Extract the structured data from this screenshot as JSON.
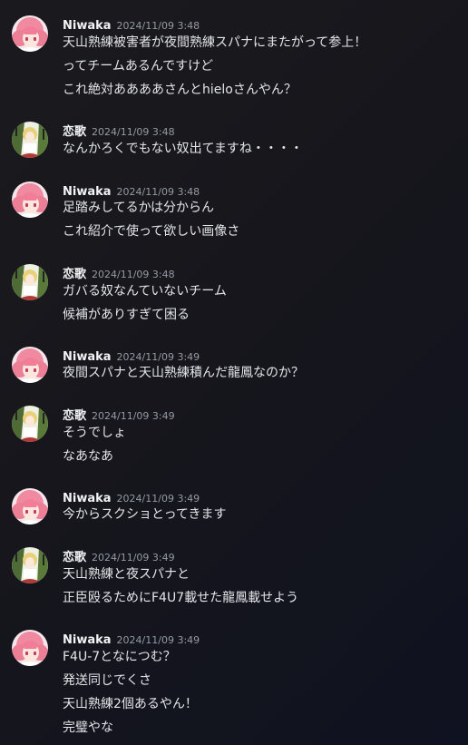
{
  "messages": [
    {
      "author": "Niwaka",
      "avatar": "niwaka-avatar",
      "timestamp": "2024/11/09 3:48",
      "lines": [
        "天山熟練被害者が夜間熟練スパナにまたがって参上！",
        "ってチームあるんですけど",
        "これ絶対ああああさんとhieloさんやん？"
      ]
    },
    {
      "author": "恋歌",
      "avatar": "renka-avatar",
      "timestamp": "2024/11/09 3:48",
      "lines": [
        "なんかろくでもない奴出てますね・・・・"
      ]
    },
    {
      "author": "Niwaka",
      "avatar": "niwaka-avatar",
      "timestamp": "2024/11/09 3:48",
      "lines": [
        "足踏みしてるかは分からん",
        "これ紹介で使って欲しい画像さ"
      ]
    },
    {
      "author": "恋歌",
      "avatar": "renka-avatar",
      "timestamp": "2024/11/09 3:48",
      "lines": [
        "ガバる奴なんていないチーム",
        "候補がありすぎて困る"
      ]
    },
    {
      "author": "Niwaka",
      "avatar": "niwaka-avatar",
      "timestamp": "2024/11/09 3:49",
      "lines": [
        "夜間スパナと天山熟練積んだ龍鳳なのか？"
      ]
    },
    {
      "author": "恋歌",
      "avatar": "renka-avatar",
      "timestamp": "2024/11/09 3:49",
      "lines": [
        "そうでしょ",
        "なあなあ"
      ]
    },
    {
      "author": "Niwaka",
      "avatar": "niwaka-avatar",
      "timestamp": "2024/11/09 3:49",
      "lines": [
        "今からスクショとってきます"
      ]
    },
    {
      "author": "恋歌",
      "avatar": "renka-avatar",
      "timestamp": "2024/11/09 3:49",
      "lines": [
        "天山熟練と夜スパナと",
        "正臣殴るためにF4U7載せた龍鳳載せよう"
      ]
    },
    {
      "author": "Niwaka",
      "avatar": "niwaka-avatar",
      "timestamp": "2024/11/09 3:49",
      "lines": [
        "F4U-7となにつむ？",
        "発送同じでくさ",
        "天山熟練2個あるやん！",
        "完璧やな"
      ]
    }
  ]
}
